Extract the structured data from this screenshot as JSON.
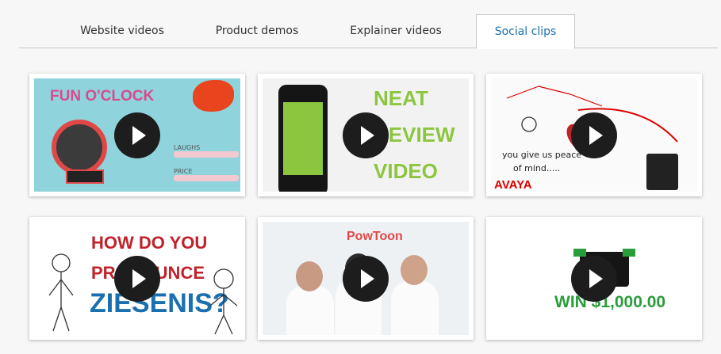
{
  "tabs": [
    {
      "label": "Website videos"
    },
    {
      "label": "Product demos"
    },
    {
      "label": "Explainer videos"
    },
    {
      "label": "Social clips",
      "active": true
    }
  ],
  "videos": [
    {
      "thumb_text": "FUN O'CLOCK",
      "labels": [
        "LAUGHS",
        "PRICE"
      ],
      "play_icon": "play-icon"
    },
    {
      "thumb_text": [
        "NEAT",
        "REVIEW",
        "VIDEO"
      ],
      "play_icon": "play-icon"
    },
    {
      "thumb_text": [
        "you give us peace",
        "of mind....."
      ],
      "brand": "AVAYA",
      "play_icon": "play-icon"
    },
    {
      "thumb_text": [
        "HOW DO YOU",
        "PRONOUNCE",
        "ZIESENIS?"
      ],
      "play_icon": "play-icon"
    },
    {
      "thumb_text": "PowToon",
      "play_icon": "play-icon"
    },
    {
      "thumb_text": "WIN $1,000.00",
      "play_icon": "play-icon"
    }
  ],
  "colors": {
    "active_tab": "#1a6fb0",
    "tab_border": "#c9c9c9",
    "card_bg": "#ffffff"
  }
}
